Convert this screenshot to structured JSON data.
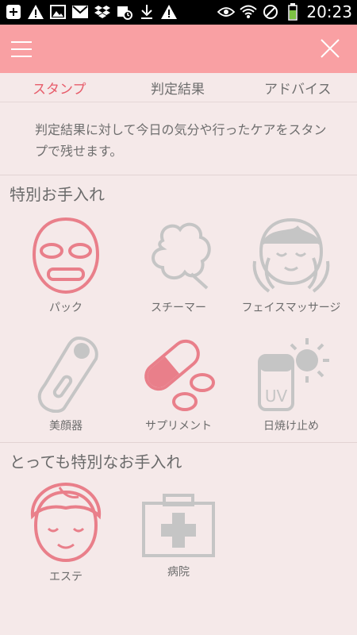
{
  "status_bar": {
    "time": "20:23"
  },
  "tabs": [
    {
      "label": "スタンプ"
    },
    {
      "label": "判定結果"
    },
    {
      "label": "アドバイス"
    }
  ],
  "intro": "判定結果に対して今日の気分や行ったケアをスタンプで残せます。",
  "sections": [
    {
      "title": "特別お手入れ",
      "items": [
        {
          "label": "パック",
          "icon": "face-mask-icon",
          "color": "#e97f8a"
        },
        {
          "label": "スチーマー",
          "icon": "steamer-icon",
          "color": "#c5c5c5"
        },
        {
          "label": "フェイスマッサージ",
          "icon": "face-massage-icon",
          "color": "#c5c5c5"
        },
        {
          "label": "美顔器",
          "icon": "beauty-device-icon",
          "color": "#c5c5c5"
        },
        {
          "label": "サプリメント",
          "icon": "supplement-icon",
          "color": "#e97f8a"
        },
        {
          "label": "日焼け止め",
          "icon": "sunscreen-icon",
          "color": "#c5c5c5"
        }
      ]
    },
    {
      "title": "とっても特別なお手入れ",
      "items": [
        {
          "label": "エステ",
          "icon": "esthetic-salon-icon",
          "color": "#e97f8a"
        },
        {
          "label": "病院",
          "icon": "hospital-icon",
          "color": "#c5c5c5"
        }
      ]
    }
  ],
  "colors": {
    "app_bar": "#f9a0a3",
    "accent": "#e75d6b",
    "selected_icon": "#e97f8a",
    "unselected_icon": "#c5c5c5",
    "background": "#f5e9e9"
  }
}
